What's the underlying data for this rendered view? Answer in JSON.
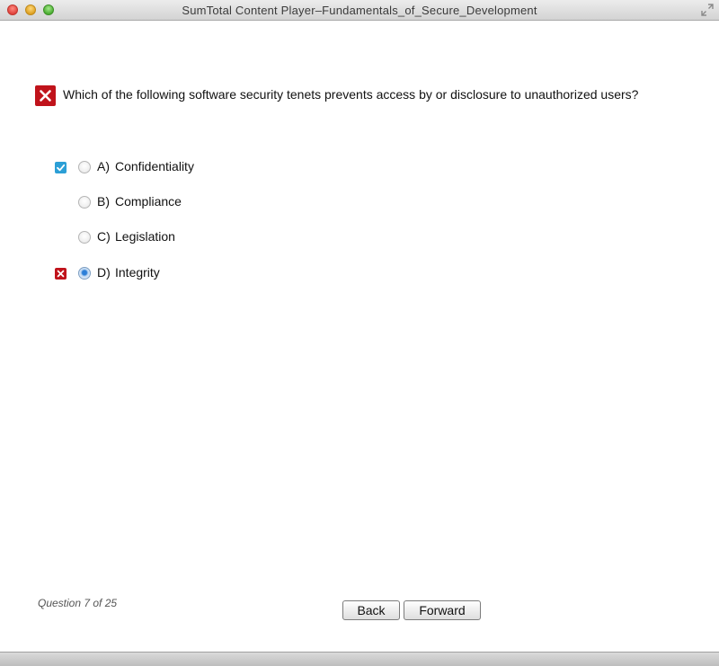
{
  "window": {
    "title": "SumTotal Content Player–Fundamentals_of_Secure_Development"
  },
  "question": {
    "status": "incorrect",
    "text": "Which of the following software security tenets prevents access by or disclosure to unauthorized users?"
  },
  "options": [
    {
      "letter": "A)",
      "text": "Confidentiality",
      "selected": false,
      "feedback": "correct-answer"
    },
    {
      "letter": "B)",
      "text": "Compliance",
      "selected": false,
      "feedback": "none"
    },
    {
      "letter": "C)",
      "text": "Legislation",
      "selected": false,
      "feedback": "none"
    },
    {
      "letter": "D)",
      "text": "Integrity",
      "selected": true,
      "feedback": "wrong-answer"
    }
  ],
  "footer": {
    "progress": "Question 7 of 25",
    "back_label": "Back",
    "forward_label": "Forward"
  },
  "colors": {
    "incorrect": "#c0131b",
    "correct": "#2c9fd6",
    "radio_selected": "#2d7fd8"
  },
  "icons": {
    "question_status": "x-mark-icon",
    "correct_mark": "checkmark-icon",
    "wrong_mark": "x-mark-icon"
  }
}
